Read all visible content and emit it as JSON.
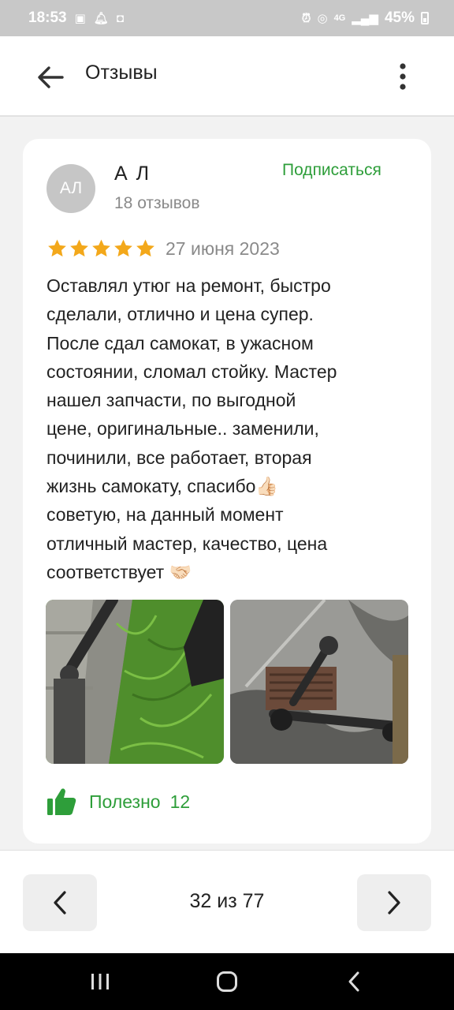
{
  "status_bar": {
    "time": "18:53",
    "network": "4G",
    "battery": "45%"
  },
  "app_bar": {
    "title": "Отзывы"
  },
  "review": {
    "author": {
      "initials": "АЛ",
      "name": "А Л",
      "review_count": "18 отзывов"
    },
    "subscribe_label": "Подписаться",
    "rating": 5,
    "rating_max": 5,
    "date": "27 июня 2023",
    "text": "Оставлял утюг на ремонт, быстро\nсделали, отлично и цена супер.\nПосле сдал самокат, в ужасном\nсостоянии, сломал стойку. Мастер\nнашел запчасти, по выгодной\nцене, оригинальные.. заменили,\nпочинили, все работает, вторая\nжизнь самокату, спасибо👍🏻\nсоветую, на данный момент\nотличный мастер, качество, цена\nсоответствует 🤝🏻",
    "helpful": {
      "label": "Полезно",
      "count": "12"
    }
  },
  "pager": {
    "text": "32 из 77"
  },
  "icons": {
    "back": "arrow-left-icon",
    "menu": "more-vertical-icon",
    "star": "star-icon",
    "thumb": "thumbs-up-icon",
    "prev": "chevron-left-icon",
    "next": "chevron-right-icon"
  },
  "colors": {
    "accent_green": "#2e9e3a",
    "star_gold": "#f3a81b",
    "muted_text": "#8a8a8a"
  }
}
